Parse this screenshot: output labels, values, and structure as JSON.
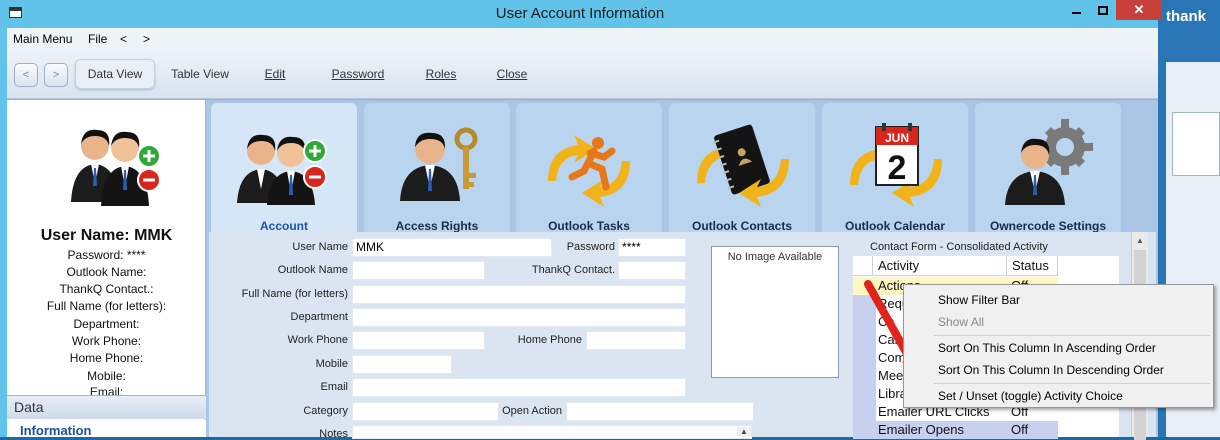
{
  "window": {
    "title": "User Account Information"
  },
  "background_logo": "thank",
  "menu": {
    "main_menu": "Main Menu",
    "file": "File",
    "back": "<",
    "forward": ">"
  },
  "toolbar": {
    "back_glyph": "<",
    "forward_glyph": ">",
    "data_view": "Data View",
    "table_view": "Table View",
    "edit": "Edit",
    "password": "Password",
    "roles": "Roles",
    "close": "Close"
  },
  "left_panel": {
    "username": "User Name: MMK",
    "lines": [
      "Password: ****",
      "Outlook Name:",
      "ThankQ Contact.:",
      "Full Name (for letters):",
      "Department:",
      "Work Phone:",
      "Home Phone:",
      "Mobile:",
      "Email:"
    ],
    "section_header": "Data",
    "section_item": "Information"
  },
  "tiles": [
    {
      "label": "Account",
      "icon": "users-add-remove-icon"
    },
    {
      "label": "Access Rights",
      "icon": "user-key-icon"
    },
    {
      "label": "Outlook Tasks",
      "icon": "running-man-sync-icon"
    },
    {
      "label": "Outlook Contacts",
      "icon": "address-book-sync-icon"
    },
    {
      "label": "Outlook Calendar",
      "icon": "calendar-sync-icon"
    },
    {
      "label": "Ownercode Settings",
      "icon": "user-gear-icon"
    }
  ],
  "calendar_month": "JUN",
  "calendar_day": "2",
  "form": {
    "user_name_label": "User Name",
    "user_name_value": "MMK",
    "password_label": "Password",
    "password_value": "****",
    "outlook_name_label": "Outlook Name",
    "outlook_name_value": "",
    "thankq_contact_label": "ThankQ Contact.",
    "thankq_contact_value": "",
    "full_name_label": "Full Name (for letters)",
    "full_name_value": "",
    "department_label": "Department",
    "department_value": "",
    "work_phone_label": "Work Phone",
    "work_phone_value": "",
    "home_phone_label": "Home Phone",
    "home_phone_value": "",
    "mobile_label": "Mobile",
    "mobile_value": "",
    "email_label": "Email",
    "email_value": "",
    "category_label": "Category",
    "category_value": "",
    "open_action_label": "Open Action",
    "open_action_value": "",
    "notes_label": "Notes",
    "no_image": "No Image Available"
  },
  "contact_form": {
    "title": "Contact Form - Consolidated Activity",
    "col_activity": "Activity",
    "col_status": "Status",
    "rows": [
      {
        "activity": "Actions",
        "status": "Off"
      },
      {
        "activity": "Requ",
        "status": ""
      },
      {
        "activity": "Ca",
        "status": ""
      },
      {
        "activity": "Can",
        "status": ""
      },
      {
        "activity": "Com",
        "status": ""
      },
      {
        "activity": "Mee",
        "status": ""
      },
      {
        "activity": "Libra",
        "status": ""
      },
      {
        "activity": "Emailer URL Clicks",
        "status": "Off"
      },
      {
        "activity": "Emailer Opens",
        "status": "Off"
      }
    ]
  },
  "context_menu": {
    "show_filter_bar": "Show Filter Bar",
    "show_all": "Show All",
    "sort_asc": "Sort On This Column In Ascending Order",
    "sort_desc": "Sort On This Column In Descending Order",
    "toggle_activity": "Set / Unset (toggle) Activity Choice"
  },
  "colors": {
    "titlebar": "#62c3ea",
    "close": "#c7413a",
    "arrow": "#e0231b",
    "accent": "#1a56a8"
  }
}
